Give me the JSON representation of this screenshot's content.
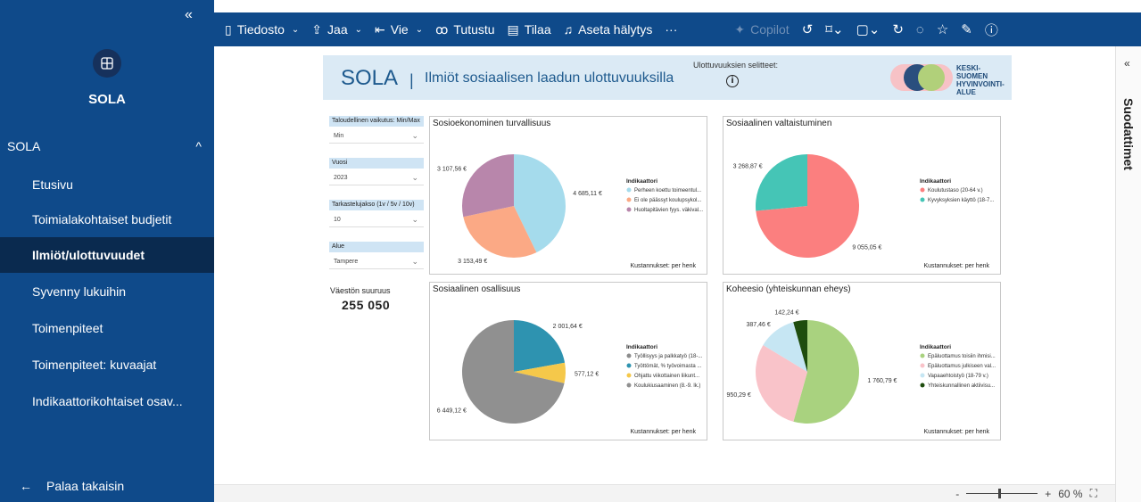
{
  "sidebar": {
    "collapse_glyph": "«",
    "logo_icon": "grid-icon",
    "app_name": "SOLA",
    "group_label": "SOLA",
    "group_chevron": "^",
    "items": [
      {
        "label": "Etusivu",
        "active": false
      },
      {
        "label": "Toimialakohtaiset budjetit",
        "active": false
      },
      {
        "label": "Ilmiöt/ulottuvuudet",
        "active": true
      },
      {
        "label": "Syvenny lukuihin",
        "active": false
      },
      {
        "label": "Toimenpiteet",
        "active": false
      },
      {
        "label": "Toimenpiteet: kuvaajat",
        "active": false
      },
      {
        "label": "Indikaattorikohtaiset osav...",
        "active": false
      }
    ],
    "back_label": "Palaa takaisin"
  },
  "toolbar": {
    "file": "Tiedosto",
    "share": "Jaa",
    "export": "Vie",
    "explore": "Tutustu",
    "subscribe": "Tilaa",
    "alert": "Aseta hälytys",
    "more": "···",
    "copilot": "Copilot"
  },
  "report": {
    "title": "SOLA",
    "separator": "|",
    "subtitle": "Ilmiöt sosiaalisen laadun ulottuvuuksilla",
    "legend_note": "Ulottuvuuksien selitteet:",
    "org_lines": [
      "KESKI-",
      "SUOMEN",
      "HYVINVOINTI-",
      "ALUE"
    ]
  },
  "slicers": [
    {
      "label": "Taloudellinen vaikutus: Min/Max",
      "value": "Min"
    },
    {
      "label": "Vuosi",
      "value": "2023"
    },
    {
      "label": "Tarkastelujakso (1v / 5v / 10v)",
      "value": "10"
    },
    {
      "label": "Alue",
      "value": "Tampere"
    }
  ],
  "population": {
    "label": "Väestön suuruus",
    "value": "255 050"
  },
  "filter_pane": {
    "label": "Suodattimet",
    "arrow": "«"
  },
  "status": {
    "zoom": "60 %",
    "minus": "-",
    "plus": "+"
  },
  "colors": {
    "sidebar": "#0f4a8a",
    "active": "#0a2a4f",
    "header_band": "#dbeaf5"
  },
  "chart_data": [
    {
      "type": "pie",
      "title": "Sosioekonominen turvallisuus",
      "legend_title": "Indikaattori",
      "footer": "Kustannukset: per henk",
      "slices": [
        {
          "label": "Perheen koettu toimeentul...",
          "value": 4685.11,
          "display": "4 685,11 €",
          "color": "#a5dbec"
        },
        {
          "label": "Ei ole päässyt koulupsykol...",
          "value": 3153.49,
          "display": "3 153,49 €",
          "color": "#fba985"
        },
        {
          "label": "Huoltapitävien fyys. väkival...",
          "value": 3107.56,
          "display": "3 107,56 €",
          "color": "#b886ab"
        }
      ]
    },
    {
      "type": "pie",
      "title": "Sosiaalinen valtaistuminen",
      "legend_title": "Indikaattori",
      "footer": "Kustannukset: per henk",
      "slices": [
        {
          "label": "Koulutustaso (20-64 v.)",
          "value": 9055.05,
          "display": "9 055,05 €",
          "color": "#fb7f7f"
        },
        {
          "label": "Kyvyksyksien käyttö (18-7...",
          "value": 3268.87,
          "display": "3 268,87 €",
          "color": "#45c5b6"
        }
      ]
    },
    {
      "type": "pie",
      "title": "Sosiaalinen osallisuus",
      "legend_title": "Indikaattori",
      "footer": "Kustannukset: per henk",
      "slices": [
        {
          "label": "Työllisyys ja palkkatyö (18-...",
          "value": 0,
          "display": "",
          "color": "#8c8c8c"
        },
        {
          "label": "Työttömät, % työvoimasta ...",
          "value": 2001.64,
          "display": "2 001,64 €",
          "color": "#2e93b0"
        },
        {
          "label": "Ohjattu viikottainen liikunt...",
          "value": 577.12,
          "display": "577,12 €",
          "color": "#f5c84a"
        },
        {
          "label": "Koulukiusaaminen (8.-9. lk.)",
          "value": 6449.12,
          "display": "6 449,12 €",
          "color": "#909090"
        }
      ]
    },
    {
      "type": "pie",
      "title": "Koheesio (yhteiskunnan eheys)",
      "legend_title": "Indikaattori",
      "footer": "Kustannukset: per henk",
      "slices": [
        {
          "label": "Epäluottamus toisiin ihmisi...",
          "value": 1760.79,
          "display": "1 760,79 €",
          "color": "#a9d27f"
        },
        {
          "label": "Epäluottamus julkiseen val...",
          "value": 950.29,
          "display": "950,29 €",
          "color": "#f9c3c9"
        },
        {
          "label": "Vapaaehtoistyö (18-79 v.)",
          "value": 387.46,
          "display": "387,46 €",
          "color": "#c6e6f3"
        },
        {
          "label": "Yhteiskunnallinen aktiivisu...",
          "value": 142.24,
          "display": "142,24 €",
          "color": "#1e4d0e"
        }
      ]
    }
  ]
}
